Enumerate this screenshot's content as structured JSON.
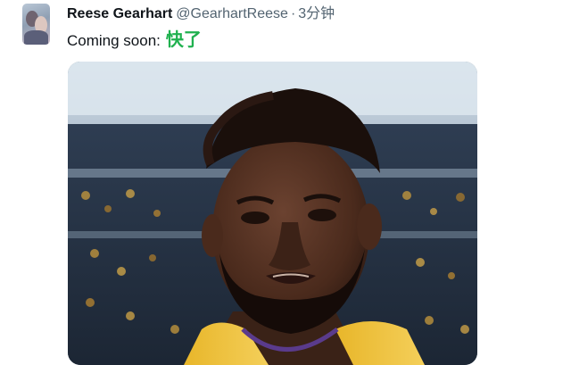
{
  "tweet": {
    "author_name": "Reese Gearhart",
    "handle": "@GearhartReese",
    "separator": "·",
    "time": "3分钟",
    "text_prefix": "Coming soon:",
    "text_emphasis": "快了"
  },
  "icons": {
    "avatar": "profile-avatar"
  },
  "colors": {
    "emphasis_text": "#20b14f",
    "secondary_text": "#536471",
    "primary_text": "#0f1419"
  }
}
